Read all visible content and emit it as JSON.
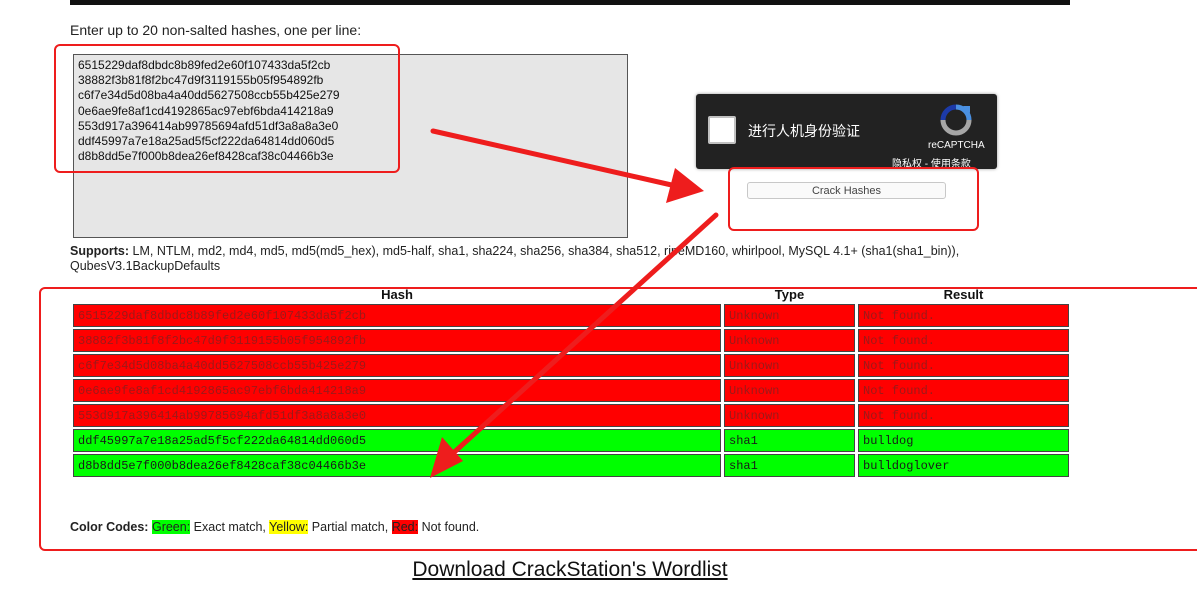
{
  "instructions": "Enter up to 20 non-salted hashes, one per line:",
  "hash_input_value": "6515229daf8dbdc8b89fed2e60f107433da5f2cb\n38882f3b81f8f2bc47d9f3119155b05f954892fb\nc6f7e34d5d08ba4a40dd5627508ccb55b425e279\n0e6ae9fe8af1cd4192865ac97ebf6bda414218a9\n553d917a396414ab99785694afd51df3a8a8a3e0\nddf45997a7e18a25ad5f5cf222da64814dd060d5\nd8b8dd5e7f000b8dea26ef8428caf38c04466b3e",
  "captcha": {
    "label": "进行人机身份验证",
    "brand": "reCAPTCHA",
    "privacy": "隐私权",
    "separator": " - ",
    "terms": "使用条款"
  },
  "crack_button_label": "Crack Hashes",
  "supports": {
    "label": "Supports:",
    "list": " LM, NTLM, md2, md4, md5, md5(md5_hex), md5-half, sha1, sha224, sha256, sha384, sha512, ripeMD160, whirlpool, MySQL 4.1+ (sha1(sha1_bin)), QubesV3.1BackupDefaults"
  },
  "table": {
    "headers": {
      "hash": "Hash",
      "type": "Type",
      "result": "Result"
    },
    "rows": [
      {
        "hash": "6515229daf8dbdc8b89fed2e60f107433da5f2cb",
        "type": "Unknown",
        "result": "Not found.",
        "status": "fail"
      },
      {
        "hash": "38882f3b81f8f2bc47d9f3119155b05f954892fb",
        "type": "Unknown",
        "result": "Not found.",
        "status": "fail"
      },
      {
        "hash": "c6f7e34d5d08ba4a40dd5627508ccb55b425e279",
        "type": "Unknown",
        "result": "Not found.",
        "status": "fail"
      },
      {
        "hash": "0e6ae9fe8af1cd4192865ac97ebf6bda414218a9",
        "type": "Unknown",
        "result": "Not found.",
        "status": "fail"
      },
      {
        "hash": "553d917a396414ab99785694afd51df3a8a8a3e0",
        "type": "Unknown",
        "result": "Not found.",
        "status": "fail"
      },
      {
        "hash": "ddf45997a7e18a25ad5f5cf222da64814dd060d5",
        "type": "sha1",
        "result": "bulldog",
        "status": "ok"
      },
      {
        "hash": "d8b8dd5e7f000b8dea26ef8428caf38c04466b3e",
        "type": "sha1",
        "result": "bulldoglover",
        "status": "ok"
      }
    ]
  },
  "legend": {
    "label": "Color Codes:",
    "green": "Green:",
    "green_desc": " Exact match, ",
    "yellow": "Yellow:",
    "yellow_desc": " Partial match, ",
    "red": "Red:",
    "red_desc": " Not found."
  },
  "download_link": "Download CrackStation's Wordlist",
  "colors": {
    "match": "#00ff00",
    "partial": "#ffff00",
    "not_found": "#ff0000",
    "annotation": "#ee1d1d"
  }
}
